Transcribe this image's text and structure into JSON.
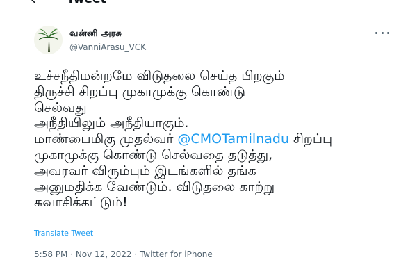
{
  "header": {
    "title": "Tweet"
  },
  "author": {
    "display_name": "வன்னி அரசு",
    "handle": "@VanniArasu_VCK"
  },
  "tweet": {
    "line1": "உச்சநீதிமன்றமே விடுதலை செய்த பிறகும்",
    "line2": "திருச்சி சிறப்பு முகாமுக்கு கொண்டு",
    "line3": "செல்வது",
    "line4": "அநீதியிலும் அநீதியாகும்.",
    "line5_before": "மாண்பைமிகு முதல்வர் ",
    "mention": "@CMOTamilnadu",
    "line5_after": " சிறப்பு",
    "line6": "முகாமுக்கு கொண்டு செல்வதை தடுத்து,",
    "line7": "அவரவர் விரும்பும் இடங்களில் தங்க",
    "line8": "அனுமதிக்க வேண்டும். விடுதலை காற்று",
    "line9": "சுவாசிக்கட்டும்!"
  },
  "translate_label": "Translate Tweet",
  "meta": {
    "time": "5:58 PM",
    "separator1": " · ",
    "date": "Nov 12, 2022",
    "separator2": " · ",
    "source": "Twitter for iPhone"
  },
  "icons": {
    "back": "arrow-left-icon",
    "more": "more-dots-icon",
    "avatar": "palm-tree-avatar"
  },
  "colors": {
    "link": "#1d9bf0",
    "text": "#0f1419",
    "secondary": "#536471"
  }
}
